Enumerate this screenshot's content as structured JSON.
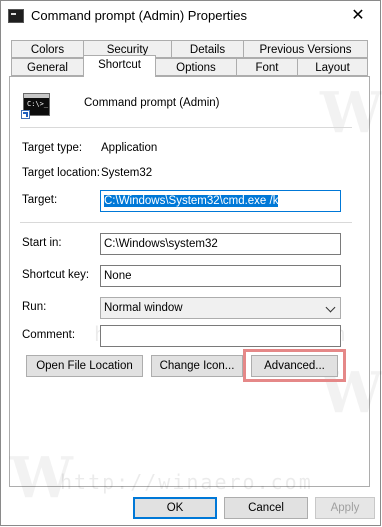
{
  "window": {
    "title": "Command prompt (Admin) Properties",
    "close_glyph": "✕"
  },
  "tabs_row1": [
    "Colors",
    "Security",
    "Details",
    "Previous Versions"
  ],
  "tabs_row2": [
    "General",
    "Shortcut",
    "Options",
    "Font",
    "Layout"
  ],
  "active_tab": "Shortcut",
  "shortcut": {
    "name": "Command prompt (Admin)",
    "icon_prompt": "C:\\>_",
    "target_type_label": "Target type:",
    "target_type_value": "Application",
    "target_location_label": "Target location:",
    "target_location_value": "System32",
    "target_label": "Target:",
    "target_value": "C:\\Windows\\System32\\cmd.exe /k",
    "start_in_label": "Start in:",
    "start_in_value": "C:\\Windows\\system32",
    "shortcut_key_label": "Shortcut key:",
    "shortcut_key_value": "None",
    "run_label": "Run:",
    "run_value": "Normal window",
    "comment_label": "Comment:",
    "comment_value": ""
  },
  "buttons": {
    "open_file_location": "Open File Location",
    "change_icon": "Change Icon...",
    "advanced": "Advanced...",
    "ok": "OK",
    "cancel": "Cancel",
    "apply": "Apply"
  },
  "watermark": {
    "url": "http://winaero.com",
    "letter": "W"
  },
  "colors": {
    "accent": "#0078d7",
    "highlight": "#e58888"
  }
}
